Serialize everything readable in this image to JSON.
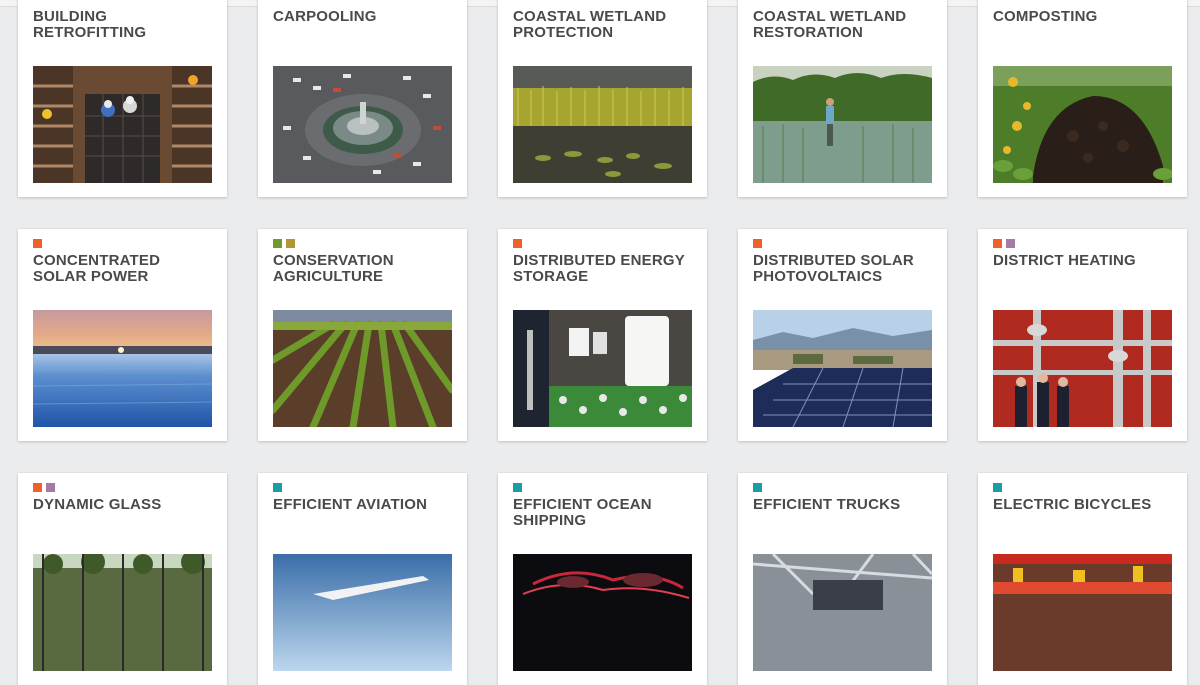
{
  "category_colors": {
    "orange": "#f0612a",
    "green": "#6f9a2c",
    "olive": "#b39631",
    "purple": "#a779a7",
    "teal": "#199ea3"
  },
  "solutions": [
    {
      "title": "BUILDING\nRETROFITTING",
      "tags": [],
      "image": "workers-on-stairs-image"
    },
    {
      "title": "CARPOOLING",
      "tags": [],
      "image": "traffic-roundabout-image"
    },
    {
      "title": "COASTAL WETLAND\nPROTECTION",
      "tags": [],
      "image": "wetland-reeds-image"
    },
    {
      "title": "COASTAL WETLAND\nRESTORATION",
      "tags": [],
      "image": "person-in-wetland-image"
    },
    {
      "title": "COMPOSTING",
      "tags": [],
      "image": "compost-pile-image"
    },
    {
      "title": "CONCENTRATED\nSOLAR POWER",
      "tags": [
        "orange"
      ],
      "image": "solar-field-sunset-image"
    },
    {
      "title": "CONSERVATION\nAGRICULTURE",
      "tags": [
        "green",
        "olive"
      ],
      "image": "crop-rows-image"
    },
    {
      "title": "DISTRIBUTED ENERGY\nSTORAGE",
      "tags": [
        "orange"
      ],
      "image": "home-battery-image"
    },
    {
      "title": "DISTRIBUTED SOLAR\nPHOTOVOLTAICS",
      "tags": [
        "orange"
      ],
      "image": "rooftop-solar-image"
    },
    {
      "title": "DISTRICT HEATING",
      "tags": [
        "orange",
        "purple"
      ],
      "image": "heating-plant-image"
    },
    {
      "title": "DYNAMIC GLASS",
      "tags": [
        "orange",
        "purple"
      ],
      "image": "glass-building-image"
    },
    {
      "title": "EFFICIENT AVIATION",
      "tags": [
        "teal"
      ],
      "image": "aircraft-sky-image"
    },
    {
      "title": "EFFICIENT OCEAN\nSHIPPING",
      "tags": [
        "teal"
      ],
      "image": "shipping-routes-map-image"
    },
    {
      "title": "EFFICIENT TRUCKS",
      "tags": [
        "teal"
      ],
      "image": "truck-structure-image"
    },
    {
      "title": "ELECTRIC BICYCLES",
      "tags": [
        "teal"
      ],
      "image": "city-street-image"
    }
  ]
}
